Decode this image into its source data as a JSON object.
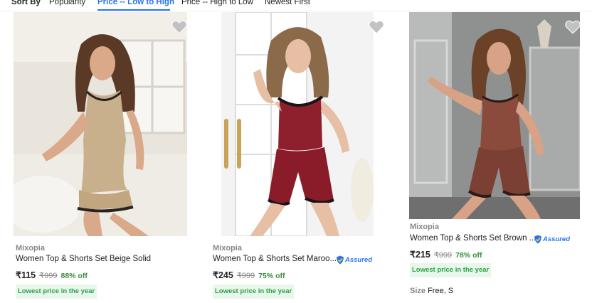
{
  "sort": {
    "label": "Sort By",
    "options": [
      "Popularity",
      "Price -- Low to High",
      "Price -- High to Low",
      "Newest First"
    ],
    "active": "Price -- Low to High"
  },
  "products": [
    {
      "brand": "Mixopia",
      "title": "Women Top & Shorts Set Beige Solid",
      "price": "₹115",
      "mrp": "₹999",
      "discount": "88% off",
      "badge": "Lowest price in the year",
      "assured": false,
      "image": "beige-satin-top-shorts-set"
    },
    {
      "brand": "Mixopia",
      "title": "Women Top & Shorts Set Maroo...",
      "price": "₹245",
      "mrp": "₹999",
      "discount": "75% off",
      "badge": "Lowest price in the year",
      "assured": true,
      "assured_label": "Assured",
      "image": "maroon-velvet-top-shorts-set"
    },
    {
      "brand": "Mixopia",
      "title": "Women Top & Shorts Set Brown ...",
      "price": "₹215",
      "mrp": "₹999",
      "discount": "78% off",
      "badge": "Lowest price in the year",
      "assured": true,
      "assured_label": "Assured",
      "size_label": "Size",
      "size_value": "Free, S",
      "image": "brown-satin-top-shorts-set"
    }
  ],
  "colors": {
    "accent": "#2874f0",
    "discount": "#388e3c",
    "badge_bg": "#e9f6ec",
    "badge_text": "#26a541",
    "muted": "#878787"
  }
}
